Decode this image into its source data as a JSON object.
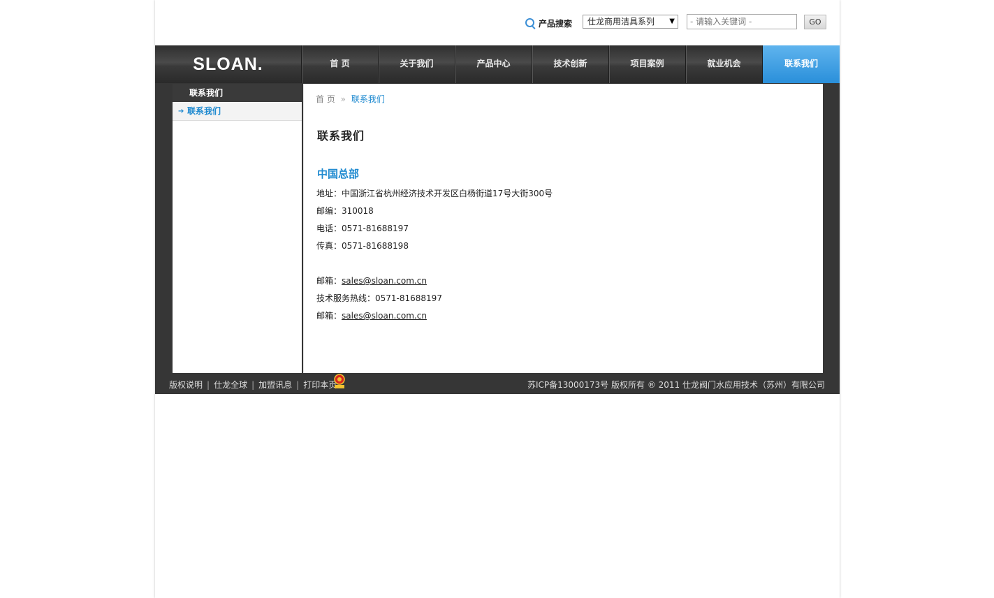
{
  "search": {
    "label": "产品搜索",
    "select_value": "仕龙商用洁具系列",
    "placeholder": "- 请输入关键词 -",
    "go_label": "GO"
  },
  "nav": {
    "logo": "SLOAN.",
    "items": [
      {
        "label": "首 页"
      },
      {
        "label": "关于我们"
      },
      {
        "label": "产品中心"
      },
      {
        "label": "技术创新"
      },
      {
        "label": "项目案例"
      },
      {
        "label": "就业机会"
      },
      {
        "label": "联系我们"
      }
    ],
    "active_color": "#3a9fe2"
  },
  "sidebar": {
    "heading": "联系我们",
    "items": [
      {
        "label": "联系我们"
      }
    ]
  },
  "breadcrumb": {
    "home": "首 页",
    "separator": "»",
    "current": "联系我们"
  },
  "content": {
    "title": "联系我们",
    "section_title": "中国总部",
    "address": "地址：中国浙江省杭州经济技术开发区白杨街道17号大街300号",
    "postcode": "邮编：310018",
    "phone": "电话：0571-81688197",
    "fax": "传真：0571-81688198",
    "email_label": "邮箱：",
    "email": "sales@sloan.com.cn",
    "hotline": "技术服务热线：0571-81688197",
    "email2_label": "邮箱：",
    "email2": "sales@sloan.com.cn"
  },
  "footer": {
    "links": [
      {
        "label": "版权说明"
      },
      {
        "label": "仕龙全球"
      },
      {
        "label": "加盟讯息"
      },
      {
        "label": "打印本页"
      }
    ],
    "separator": "|",
    "copyright": "苏ICP备13000173号 版权所有 ® 2011 仕龙阀门水应用技术（苏州）有限公司"
  }
}
